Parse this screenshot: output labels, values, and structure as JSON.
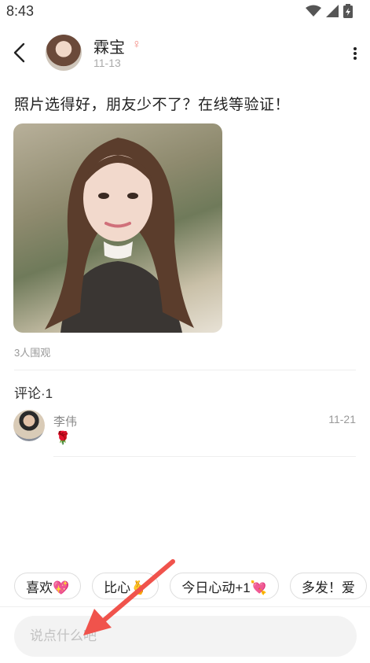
{
  "status_bar": {
    "time": "8:43"
  },
  "header": {
    "name": "霖宝",
    "date": "11-13"
  },
  "post": {
    "text": "照片选得好，朋友少不了？在线等验证！",
    "onlookers": "3人围观"
  },
  "comments": {
    "title": "评论·1",
    "items": [
      {
        "name": "李伟",
        "date": "11-21",
        "body": "🌹"
      }
    ]
  },
  "quick_replies": [
    "喜欢💖",
    "比心🫰",
    "今日心动+1💘",
    "多发！爱"
  ],
  "input": {
    "placeholder": "说点什么吧"
  },
  "colors": {
    "accent": "#f0534c",
    "female": "#f28b82"
  }
}
